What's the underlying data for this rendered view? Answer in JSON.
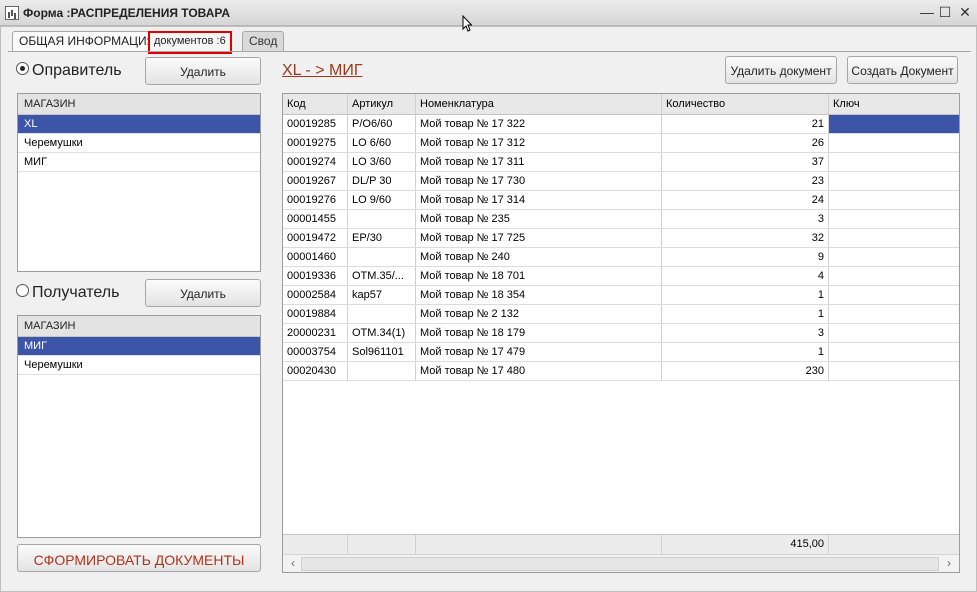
{
  "window": {
    "title": "Форма :РАСПРЕДЕЛЕНИЯ ТОВАРА",
    "minimize": "—",
    "maximize": "☐",
    "close": "✕"
  },
  "tabs": [
    {
      "label": "ОБЩАЯ ИНФОРМАЦИЯ"
    },
    {
      "label": "документов :6"
    },
    {
      "label": "Свод"
    }
  ],
  "sender": {
    "label": "Оправитель",
    "delete_label": "Удалить",
    "list_header": "МАГАЗИН",
    "items": [
      "XL",
      "Черемушки",
      "МИГ"
    ],
    "selected_index": 0
  },
  "receiver": {
    "label": "Получатель",
    "delete_label": "Удалить",
    "list_header": "МАГАЗИН",
    "items": [
      "МИГ",
      "Черемушки"
    ],
    "selected_index": 0
  },
  "route": {
    "label": "XL - > МИГ"
  },
  "actions": {
    "delete_document": "Удалить документ",
    "create_document": "Создать Документ",
    "generate_documents": "СФОРМИРОВАТЬ ДОКУМЕНТЫ"
  },
  "table": {
    "columns": [
      "Код",
      "Артикул",
      "Номенклатура",
      "Количество",
      "Ключ"
    ],
    "rows": [
      [
        "00019285",
        "P/O6/60",
        "Мой товар № 17 322",
        "21",
        ""
      ],
      [
        "00019275",
        "LO 6/60",
        "Мой товар № 17 312",
        "26",
        ""
      ],
      [
        "00019274",
        "LO 3/60",
        "Мой товар № 17 311",
        "37",
        ""
      ],
      [
        "00019267",
        "DL/P 30",
        "Мой товар № 17 730",
        "23",
        ""
      ],
      [
        "00019276",
        "LO 9/60",
        "Мой товар № 17 314",
        "24",
        ""
      ],
      [
        "00001455",
        "",
        "Мой товар № 235",
        "3",
        ""
      ],
      [
        "00019472",
        "EP/30",
        "Мой товар № 17 725",
        "32",
        ""
      ],
      [
        "00001460",
        "",
        "Мой товар № 240",
        "9",
        ""
      ],
      [
        "00019336",
        "OTM.35/...",
        "Мой товар № 18 701",
        "4",
        ""
      ],
      [
        "00002584",
        "kap57",
        "Мой товар № 18 354",
        "1",
        ""
      ],
      [
        "00019884",
        "",
        "Мой товар № 2 132",
        "1",
        ""
      ],
      [
        "20000231",
        "OTM.34(1)",
        "Мой товар № 18 179",
        "3",
        ""
      ],
      [
        "00003754",
        "Sol961101",
        "Мой товар № 17 479",
        "1",
        ""
      ],
      [
        "00020430",
        "",
        "Мой товар № 17 480",
        "230",
        ""
      ]
    ],
    "total_quantity": "415,00"
  },
  "colors": {
    "selection": "#3c55a8",
    "highlight_border": "#e00000",
    "accent_text": "#b0331a"
  }
}
